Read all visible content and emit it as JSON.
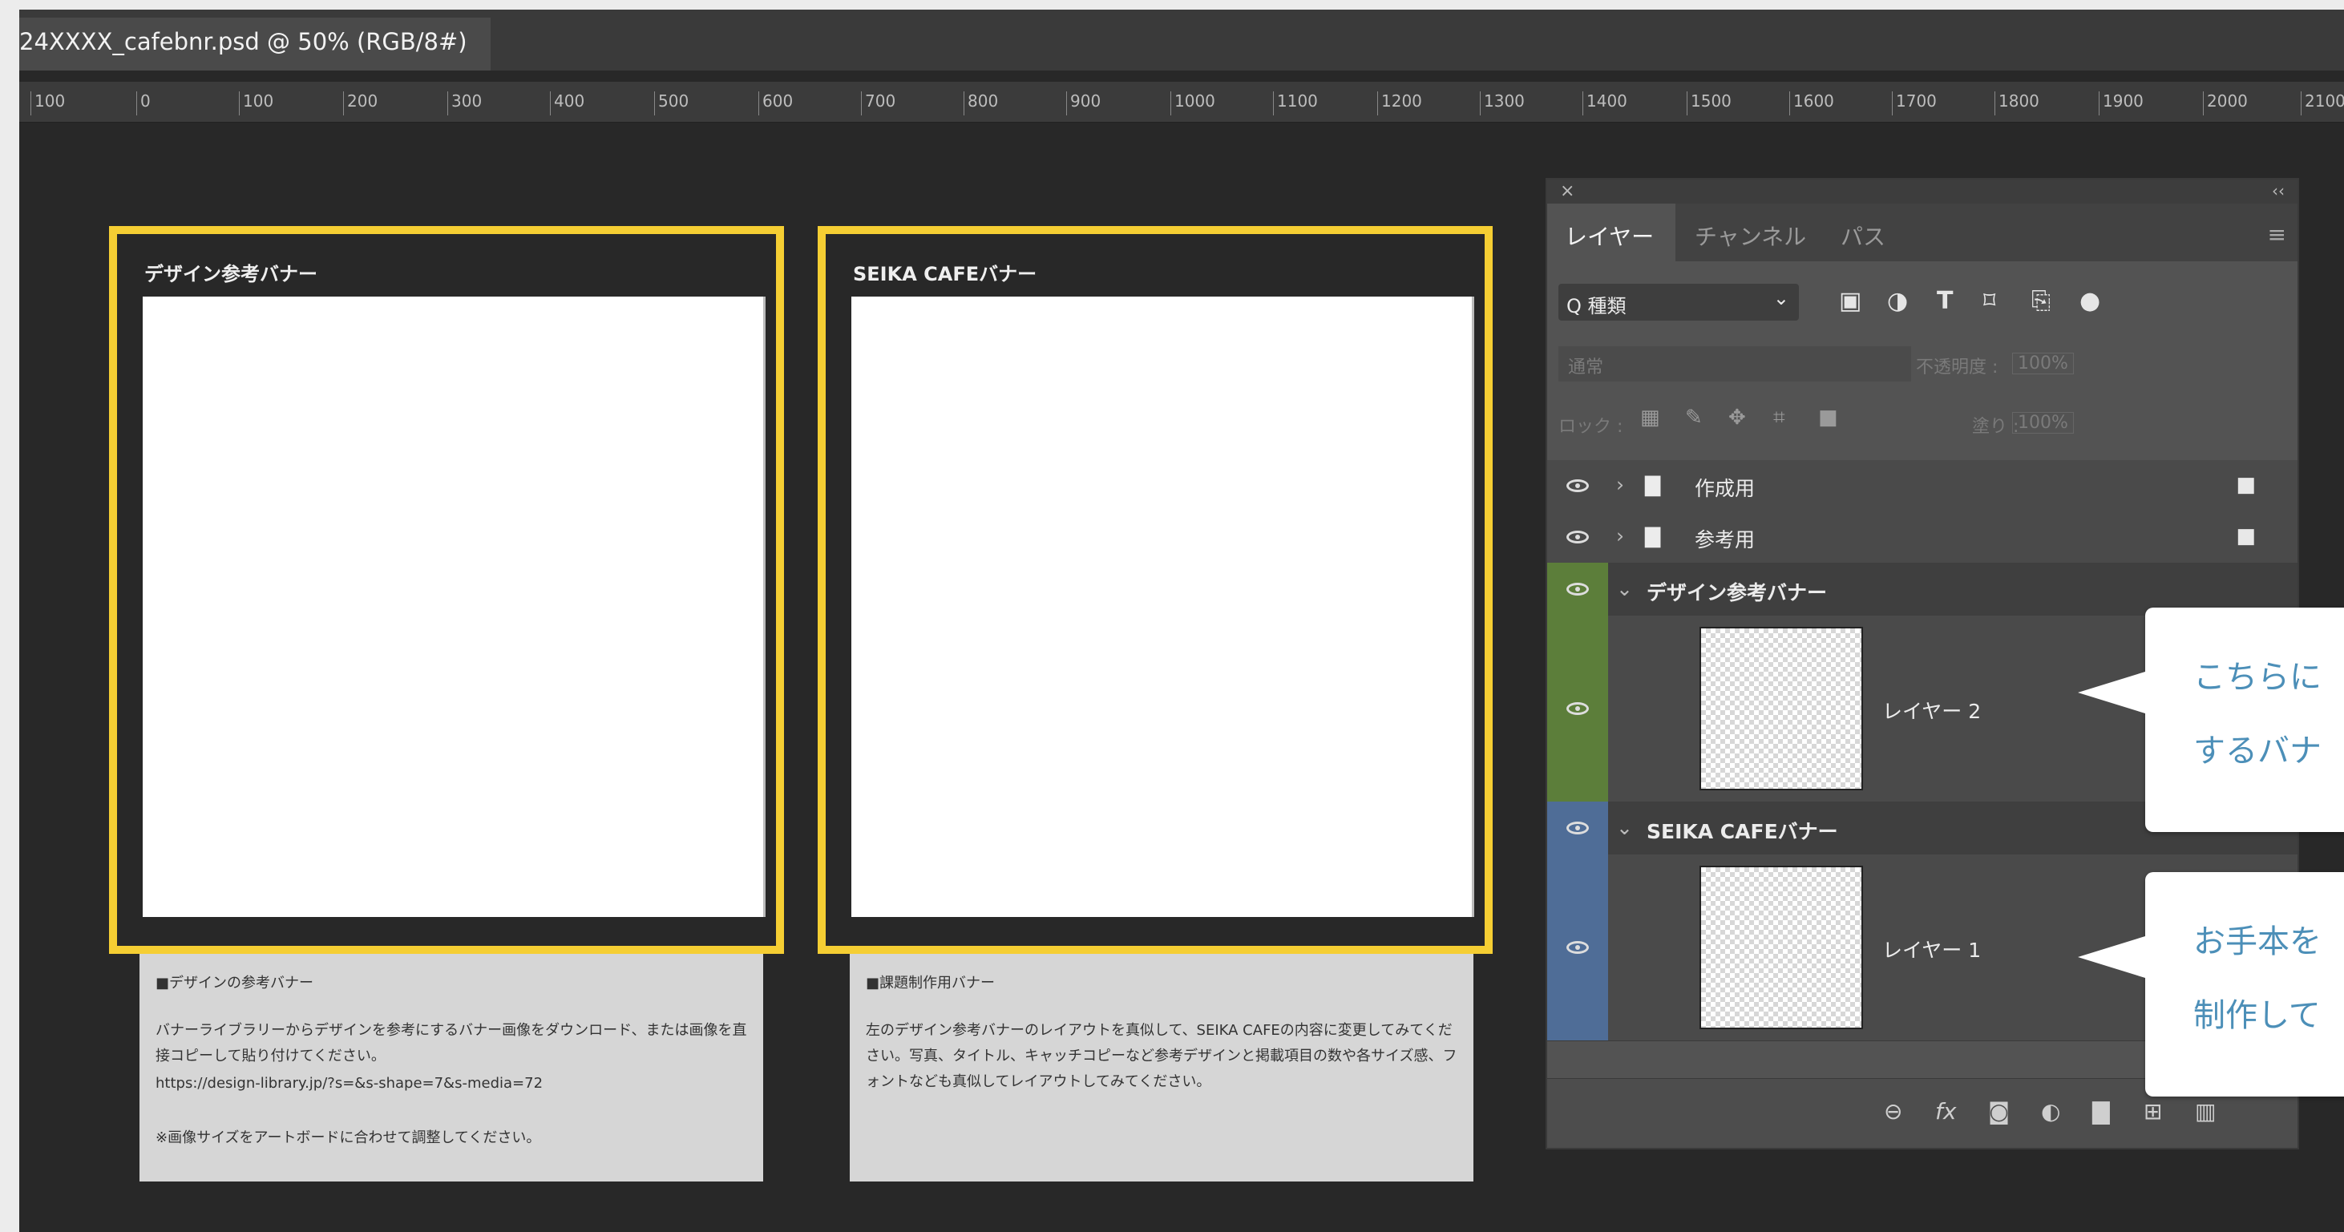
{
  "document": {
    "tab_title": "24XXXX_cafebnr.psd @ 50% (RGB/8#)"
  },
  "ruler": {
    "ticks": [
      "100",
      "0",
      "100",
      "200",
      "300",
      "400",
      "500",
      "600",
      "700",
      "800",
      "900",
      "1000",
      "1100",
      "1200",
      "1300",
      "1400",
      "1500",
      "1600",
      "1700",
      "1800",
      "1900",
      "2000",
      "2100"
    ]
  },
  "artboards": [
    {
      "title": "デザイン参考バナー",
      "note_heading": "■デザインの参考バナー",
      "note_body": "バナーライブラリーからデザインを参考にするバナー画像をダウンロード、または画像を直接コピーして貼り付けてください。",
      "note_url": "https://design-library.jp/?s=&s-shape=7&s-media=72",
      "note_footer": "※画像サイズをアートボードに合わせて調整してください。"
    },
    {
      "title": "SEIKA CAFEバナー",
      "note_heading": "■課題制作用バナー",
      "note_body": "左のデザイン参考バナーのレイアウトを真似して、SEIKA CAFEの内容に変更してみてください。写真、タイトル、キャッチコピーなど参考デザインと掲載項目の数や各サイズ感、フォントなども真似してレイアウトしてみてください。"
    }
  ],
  "layers_panel": {
    "close_icon": "×",
    "collapse_icon": "‹‹",
    "tabs": [
      "レイヤー",
      "チャンネル",
      "パス"
    ],
    "active_tab": "レイヤー",
    "menu_icon": "≡",
    "filter_label": "Q 種類",
    "filter_arrow": "⌄",
    "blend_mode": "通常",
    "opacity_label": "不透明度 :",
    "opacity_value": "100%",
    "lock_label": "ロック :",
    "fill_label": "塗り :",
    "fill_value": "100%",
    "layers": [
      {
        "name": "作成用",
        "kind": "group",
        "expanded": false,
        "locked": true
      },
      {
        "name": "参考用",
        "kind": "group",
        "expanded": false,
        "locked": true
      },
      {
        "name": "デザイン参考バナー",
        "kind": "artboard",
        "expanded": true,
        "color": "#5c7e3a"
      },
      {
        "name": "レイヤー 2",
        "kind": "layer",
        "color": "#5c7e3a"
      },
      {
        "name": "SEIKA CAFEバナー",
        "kind": "artboard",
        "expanded": true,
        "color": "#4f6d97"
      },
      {
        "name": "レイヤー 1",
        "kind": "layer",
        "color": "#4f6d97"
      }
    ],
    "bottom_icons": [
      "link-icon",
      "fx-icon",
      "mask-icon",
      "adjustment-icon",
      "folder-icon",
      "new-layer-icon",
      "trash-icon"
    ]
  },
  "callouts": [
    {
      "line1": "こちらに",
      "line2": "するバナ"
    },
    {
      "line1": "お手本を",
      "line2": "制作して"
    }
  ],
  "colors": {
    "artboard_border": "#f5ce33",
    "callout_text": "#4c8fb8",
    "green_label": "#5c7e3a",
    "blue_label": "#4f6d97"
  }
}
